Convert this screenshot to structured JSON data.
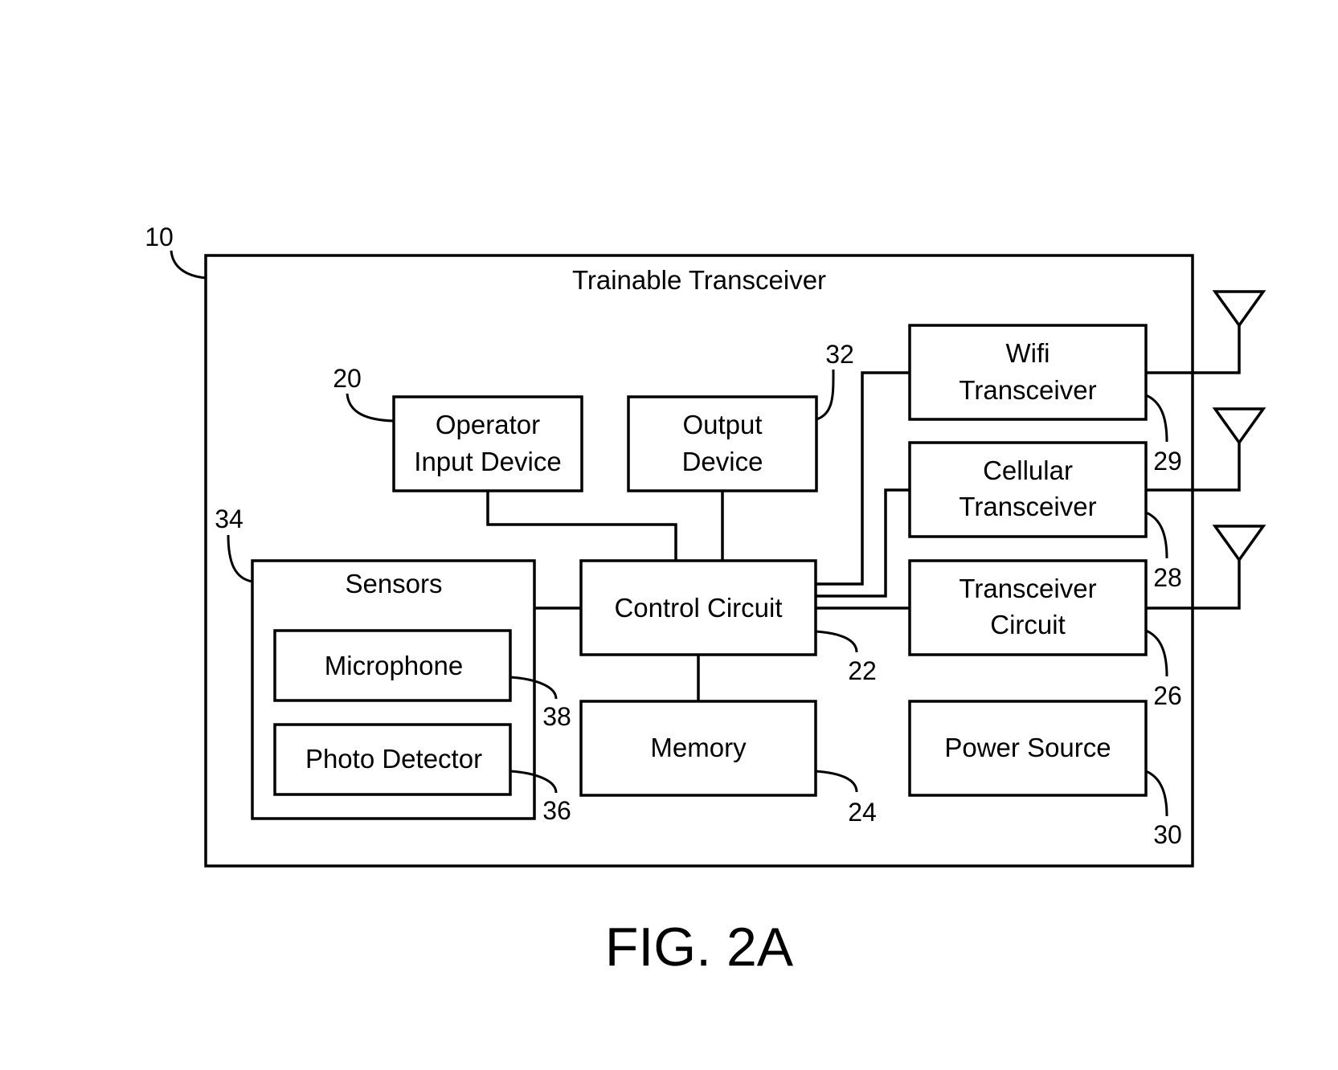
{
  "figure": {
    "caption": "FIG. 2A",
    "system": {
      "title": "Trainable Transceiver",
      "ref": "10"
    },
    "blocks": {
      "operator_input": {
        "lines": [
          "Operator",
          "Input Device"
        ],
        "ref": "20"
      },
      "output_device": {
        "lines": [
          "Output",
          "Device"
        ],
        "ref": "32"
      },
      "control_circuit": {
        "lines": [
          "Control Circuit"
        ],
        "ref": "22"
      },
      "memory": {
        "lines": [
          "Memory"
        ],
        "ref": "24"
      },
      "sensors": {
        "lines": [
          "Sensors"
        ],
        "ref": "34"
      },
      "microphone": {
        "lines": [
          "Microphone"
        ],
        "ref": "38"
      },
      "photo_detector": {
        "lines": [
          "Photo Detector"
        ],
        "ref": "36"
      },
      "wifi": {
        "lines": [
          "Wifi",
          "Transceiver"
        ],
        "ref": "29"
      },
      "cellular": {
        "lines": [
          "Cellular",
          "Transceiver"
        ],
        "ref": "28"
      },
      "transceiver_circuit": {
        "lines": [
          "Transceiver",
          "Circuit"
        ],
        "ref": "26"
      },
      "power_source": {
        "lines": [
          "Power Source"
        ],
        "ref": "30"
      }
    },
    "antenna_count": 3,
    "connections": [
      [
        "operator_input",
        "control_circuit"
      ],
      [
        "output_device",
        "control_circuit"
      ],
      [
        "sensors",
        "control_circuit"
      ],
      [
        "control_circuit",
        "memory"
      ],
      [
        "control_circuit",
        "wifi"
      ],
      [
        "control_circuit",
        "cellular"
      ],
      [
        "control_circuit",
        "transceiver_circuit"
      ],
      [
        "wifi",
        "antenna"
      ],
      [
        "cellular",
        "antenna"
      ],
      [
        "transceiver_circuit",
        "antenna"
      ]
    ]
  }
}
